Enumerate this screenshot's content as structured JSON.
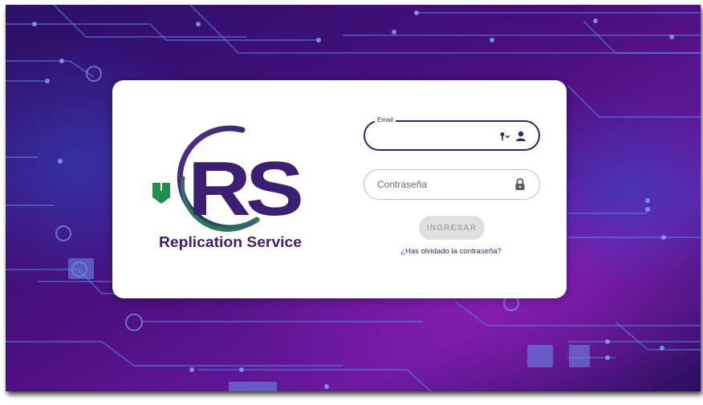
{
  "brand": {
    "logo_letters": "RS",
    "logo_text": "Replication Service"
  },
  "login_form": {
    "email_label": "Email",
    "email_value": "",
    "password_placeholder": "Contraseña",
    "submit_label": "INGRESAR",
    "forgot_link": "¿Has olvidado la contraseña?"
  },
  "icons": {
    "email_field": [
      "key-dropdown-icon",
      "person-icon"
    ],
    "password_field": "lock-icon"
  },
  "colors": {
    "brand_purple": "#3b1f73",
    "accent_green": "#1f8f4c",
    "button_disabled_bg": "#e0e0e0",
    "button_disabled_text": "#a8a8a8",
    "background_dark": "#1a0a3a",
    "background_purple": "#6a1aa0"
  }
}
